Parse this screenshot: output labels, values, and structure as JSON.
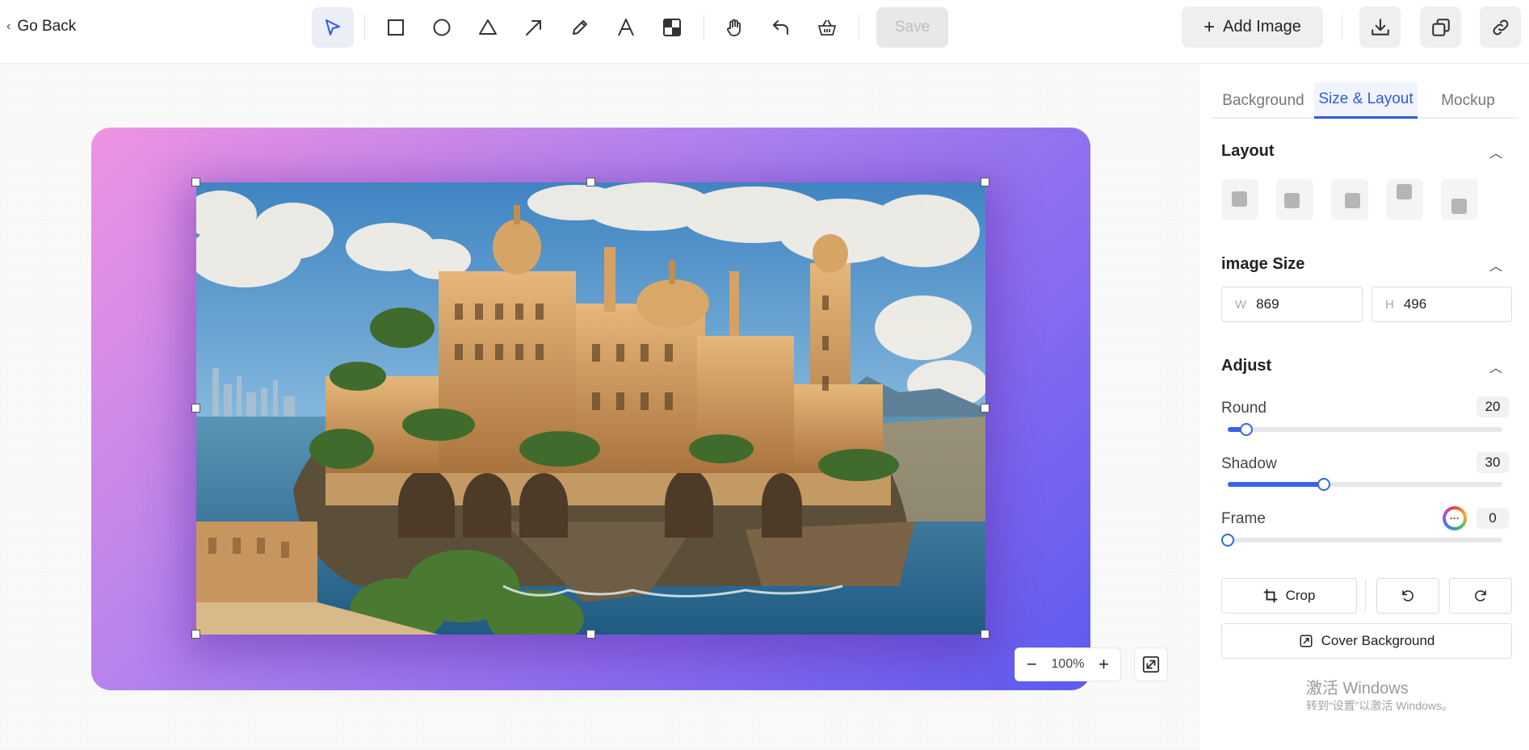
{
  "topbar": {
    "go_back_label": "Go Back",
    "tools": [
      {
        "name": "select",
        "icon": "cursor-arrow-icon",
        "active": true
      },
      {
        "name": "rectangle",
        "icon": "square-icon"
      },
      {
        "name": "ellipse",
        "icon": "circle-icon"
      },
      {
        "name": "triangle",
        "icon": "triangle-icon"
      },
      {
        "name": "arrow",
        "icon": "arrow-icon"
      },
      {
        "name": "pen",
        "icon": "pencil-icon"
      },
      {
        "name": "text",
        "icon": "text-icon"
      },
      {
        "name": "pixelate",
        "icon": "mosaic-icon"
      },
      {
        "name": "pan",
        "icon": "hand-icon"
      },
      {
        "name": "undo",
        "icon": "undo-icon"
      },
      {
        "name": "clear",
        "icon": "basket-icon"
      }
    ],
    "save_label": "Save",
    "add_image_label": "Add Image",
    "icon_buttons": [
      "download-icon",
      "copy-icon",
      "link-icon"
    ]
  },
  "canvas": {
    "gradient_colors": [
      "#ee93e2",
      "#a97fee",
      "#5d5bf0"
    ],
    "zoom_label": "100%",
    "zoom_out": "−",
    "zoom_in": "+"
  },
  "panel": {
    "tabs": [
      {
        "label": "Background",
        "active": false
      },
      {
        "label": "Size & Layout",
        "active": true
      },
      {
        "label": "Mockup",
        "active": false
      }
    ],
    "layout_title": "Layout",
    "image_size_title": "image Size",
    "width_label": "W",
    "width_value": "869",
    "height_label": "H",
    "height_value": "496",
    "adjust_title": "Adjust",
    "round_label": "Round",
    "round_value": "20",
    "round_fraction": 0.067,
    "shadow_label": "Shadow",
    "shadow_value": "30",
    "shadow_fraction": 0.35,
    "frame_label": "Frame",
    "frame_value": "0",
    "frame_fraction": 0,
    "crop_label": "Crop",
    "cover_background_label": "Cover Background",
    "accent_color": "#2f5be0"
  },
  "watermark": {
    "line1": "激活 Windows",
    "line2": "转到“设置”以激活 Windows。"
  }
}
